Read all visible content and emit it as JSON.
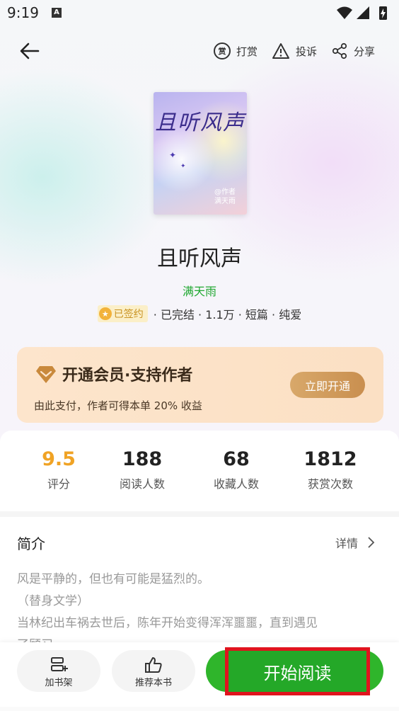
{
  "status_bar": {
    "time": "9:19",
    "notification_glyph": "A"
  },
  "nav": {
    "reward_icon_glyph": "赏",
    "reward_label": "打赏",
    "report_label": "投诉",
    "share_label": "分享"
  },
  "book": {
    "cover_title": "且听风声",
    "cover_author_lines": [
      "@作者",
      "满天雨"
    ],
    "title": "且听风声",
    "author": "满天雨",
    "signed_badge": "已签约",
    "meta": "· 已完结 · 1.1万  · 短篇 · 纯爱"
  },
  "vip": {
    "title": "开通会员·支持作者",
    "description": "由此支付，作者可得本单 20% 收益",
    "button_label": "立即开通"
  },
  "stats": [
    {
      "value": "9.5",
      "label": "评分"
    },
    {
      "value": "188",
      "label": "阅读人数"
    },
    {
      "value": "68",
      "label": "收藏人数"
    },
    {
      "value": "1812",
      "label": "获赏次数"
    }
  ],
  "intro": {
    "heading": "简介",
    "detail_label": "详情",
    "lines": [
      "风是平静的，但也有可能是猛烈的。",
      "（替身文学）",
      "当林纪出车祸去世后，陈年开始变得浑浑噩噩，直到遇见",
      "了顾习"
    ]
  },
  "bottom_bar": {
    "shelf_label": "加书架",
    "recommend_label": "推荐本书",
    "start_label": "开始阅读"
  },
  "colors": {
    "accent_green": "#2fb52b",
    "author_green": "#21a832",
    "rating_orange": "#f0a325",
    "highlight_red": "#e0141e"
  }
}
